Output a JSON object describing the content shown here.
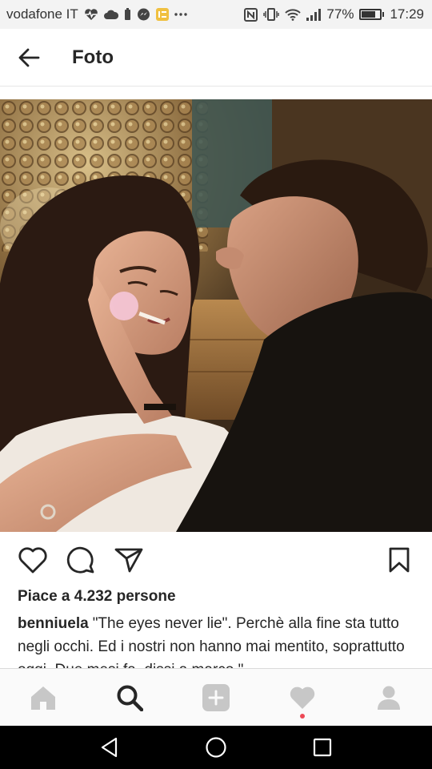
{
  "status_bar": {
    "carrier": "vodafone IT",
    "battery_percent": "77%",
    "battery_level": 0.77,
    "time": "17:29",
    "icons": [
      "heart-pulse-icon",
      "cloud-icon",
      "battery-saver-icon",
      "messenger-icon",
      "app-icon",
      "more-dots-icon",
      "nfc-icon",
      "vibrate-icon",
      "wifi-icon",
      "signal-icon",
      "battery-icon"
    ]
  },
  "header": {
    "title": "Foto",
    "back_icon": "arrow-left-icon"
  },
  "post": {
    "likes_text": "Piace a 4.232 persone",
    "username": "benniuela",
    "caption": "\"The eyes never lie\". Perchè alla fine sta tutto negli occhi. Ed i nostri non hanno mai mentito, soprattutto oggi. Due mesi fa, dissi a marco.\"",
    "actions": [
      "heart-icon",
      "comment-icon",
      "share-icon",
      "bookmark-icon"
    ]
  },
  "bottom_nav": {
    "items": [
      "home-icon",
      "search-icon",
      "add-post-icon",
      "activity-heart-icon",
      "profile-icon"
    ],
    "active": "search-icon",
    "notification_dot_color": "#ed4956"
  },
  "android_nav": {
    "items": [
      "back-triangle-icon",
      "home-circle-icon",
      "recents-square-icon"
    ]
  }
}
